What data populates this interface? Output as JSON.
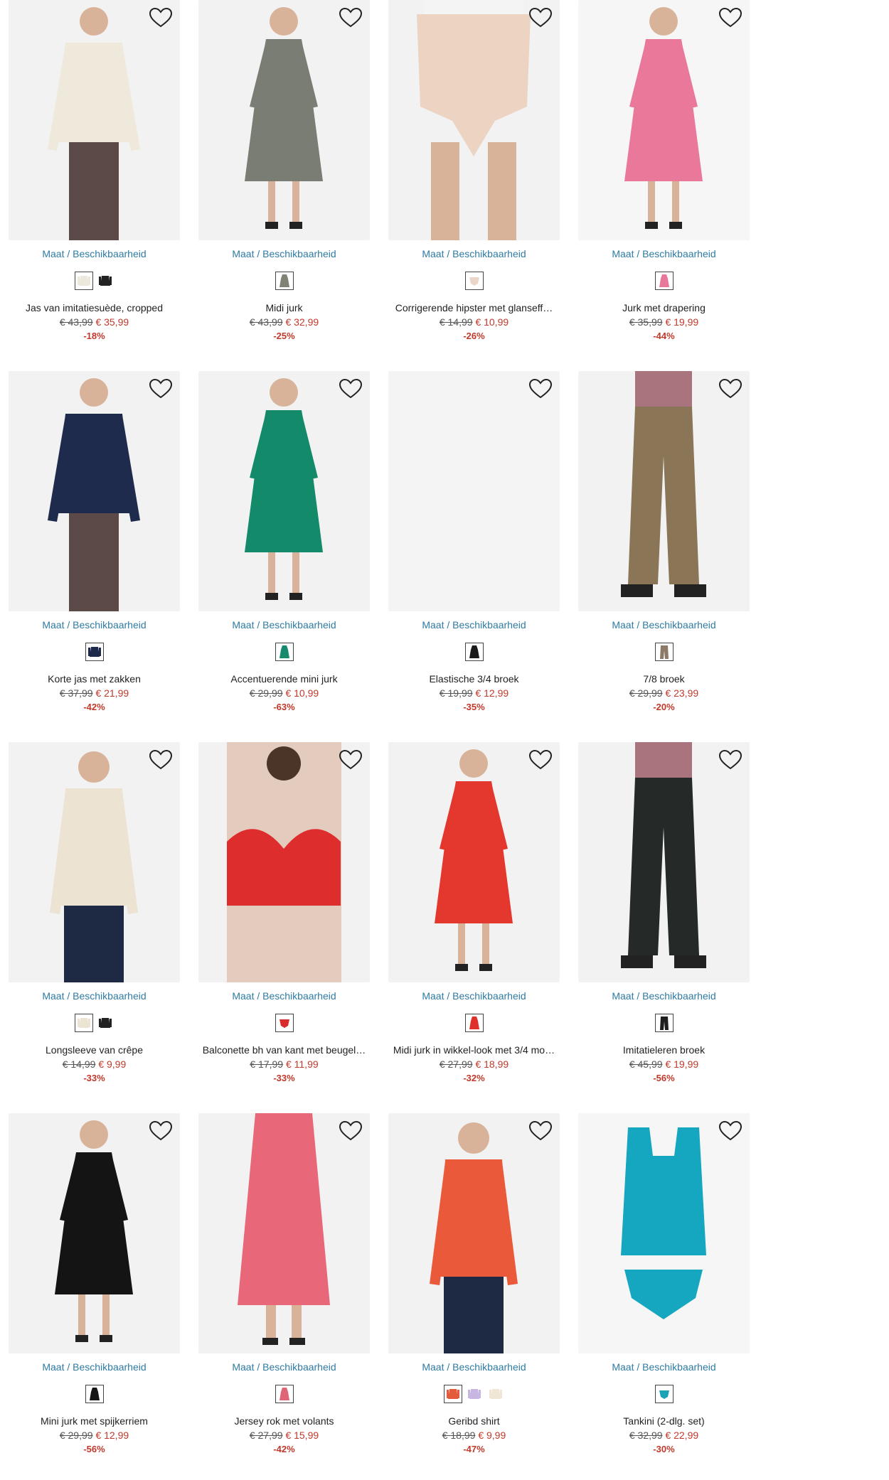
{
  "size_link_label": "Maat / Beschikbaarheid",
  "colors": {
    "link": "#2f7ba3",
    "sale": "#c0392b",
    "old_price": "#555555"
  },
  "products": [
    {
      "title": "Jas van imitatiesuède, cropped",
      "old_price": "€ 43,99",
      "new_price": "€ 35,99",
      "discount": "-18%",
      "swatches": [
        "#ece8dc",
        "#222222"
      ],
      "bg": "#f2f2f2",
      "garment": "#efe9dc",
      "kind": "jacket"
    },
    {
      "title": "Midi jurk",
      "old_price": "€ 43,99",
      "new_price": "€ 32,99",
      "discount": "-25%",
      "swatches": [
        "#7f8274"
      ],
      "bg": "#f2f2f2",
      "garment": "#7a7d73",
      "kind": "dress"
    },
    {
      "title": "Corrigerende hipster met glanseff…",
      "old_price": "€ 14,99",
      "new_price": "€ 10,99",
      "discount": "-26%",
      "swatches": [
        "#ecd6c8"
      ],
      "bg": "#f2f2f2",
      "garment": "#ecd3c2",
      "kind": "brief"
    },
    {
      "title": "Jurk met drapering",
      "old_price": "€ 35,99",
      "new_price": "€ 19,99",
      "discount": "-44%",
      "swatches": [
        "#e8789a"
      ],
      "bg": "#f6f6f6",
      "garment": "#e9789a",
      "kind": "dress"
    },
    {
      "title": "Korte jas met zakken",
      "old_price": "€ 37,99",
      "new_price": "€ 21,99",
      "discount": "-42%",
      "swatches": [
        "#1e2a4a"
      ],
      "bg": "#f2f2f2",
      "garment": "#1f2b4d",
      "kind": "jacket"
    },
    {
      "title": "Accentuerende mini jurk",
      "old_price": "€ 29,99",
      "new_price": "€ 10,99",
      "discount": "-63%",
      "swatches": [
        "#178a6e"
      ],
      "bg": "#f2f2f2",
      "garment": "#138a6a",
      "kind": "dress"
    },
    {
      "title": "Elastische 3/4 broek",
      "old_price": "€ 19,99",
      "new_price": "€ 12,99",
      "discount": "-35%",
      "swatches": [
        "#1a1a1a"
      ],
      "bg": "#f4f4f4",
      "garment": "#f4f4f4",
      "kind": "empty"
    },
    {
      "title": "7/8 broek",
      "old_price": "€ 29,99",
      "new_price": "€ 23,99",
      "discount": "-20%",
      "swatches": [
        "#8a7a66"
      ],
      "bg": "#f2f2f2",
      "garment": "#8b7557",
      "kind": "pants"
    },
    {
      "title": "Longsleeve van crêpe",
      "old_price": "€ 14,99",
      "new_price": "€ 9,99",
      "discount": "-33%",
      "swatches": [
        "#ece4d2",
        "#222222"
      ],
      "bg": "#f2f2f2",
      "garment": "#ece3d3",
      "kind": "top"
    },
    {
      "title": "Balconette bh van kant met beugel…",
      "old_price": "€ 17,99",
      "new_price": "€ 11,99",
      "discount": "-33%",
      "swatches": [
        "#d82b2b"
      ],
      "bg": "#f2f2f2",
      "garment": "#de2d2d",
      "kind": "bra"
    },
    {
      "title": "Midi jurk in wikkel-look met 3/4 mo…",
      "old_price": "€ 27,99",
      "new_price": "€ 18,99",
      "discount": "-32%",
      "swatches": [
        "#e0302c"
      ],
      "bg": "#f2f2f2",
      "garment": "#e4372d",
      "kind": "dress"
    },
    {
      "title": "Imitatieleren broek",
      "old_price": "€ 45,99",
      "new_price": "€ 19,99",
      "discount": "-56%",
      "swatches": [
        "#1e1e1e"
      ],
      "bg": "#f2f2f2",
      "garment": "#252a28",
      "kind": "pants"
    },
    {
      "title": "Mini jurk met spijkerriem",
      "old_price": "€ 29,99",
      "new_price": "€ 12,99",
      "discount": "-56%",
      "swatches": [
        "#151515"
      ],
      "bg": "#f2f2f2",
      "garment": "#141414",
      "kind": "dress"
    },
    {
      "title": "Jersey rok met volants",
      "old_price": "€ 27,99",
      "new_price": "€ 15,99",
      "discount": "-42%",
      "swatches": [
        "#e06478"
      ],
      "bg": "#f2f2f2",
      "garment": "#e8687a",
      "kind": "skirt"
    },
    {
      "title": "Geribd shirt",
      "old_price": "€ 18,99",
      "new_price": "€ 9,99",
      "discount": "-47%",
      "swatches": [
        "#e45a3c",
        "#c7b6e0",
        "#efe6d6"
      ],
      "bg": "#f2f2f2",
      "garment": "#ea5a3a",
      "kind": "top"
    },
    {
      "title": "Tankini (2-dlg. set)",
      "old_price": "€ 32,99",
      "new_price": "€ 22,99",
      "discount": "-30%",
      "swatches": [
        "#1aa3b6"
      ],
      "bg": "#f6f6f6",
      "garment": "#16a7c0",
      "kind": "swim"
    }
  ]
}
